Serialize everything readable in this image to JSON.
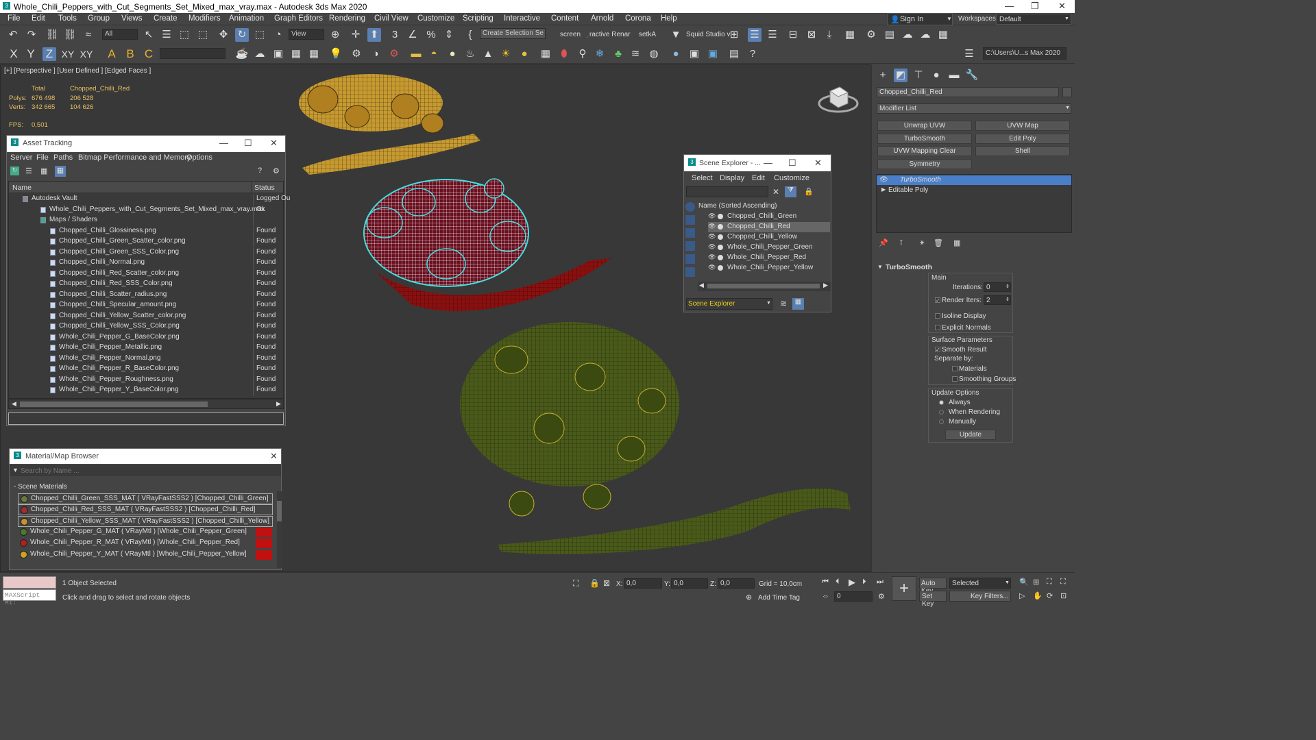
{
  "window": {
    "title": "Whole_Chili_Peppers_with_Cut_Segments_Set_Mixed_max_vray.max - Autodesk 3ds Max 2020"
  },
  "menu": [
    "File",
    "Edit",
    "Tools",
    "Group",
    "Views",
    "Create",
    "Modifiers",
    "Animation",
    "Graph Editors",
    "Rendering",
    "Civil View",
    "Customize",
    "Scripting",
    "Interactive",
    "Content",
    "Arnold",
    "Corona",
    "Help"
  ],
  "account": {
    "sign_in": "Sign In",
    "workspaces_label": "Workspaces:",
    "workspace": "Default"
  },
  "toolbar": {
    "filter": "All",
    "ref_coord": "View",
    "selection_set": "Create Selection Se",
    "screen": "screen",
    "interactive_render": "̣ractive Renar",
    "setka": "setkA",
    "squid": "Squid Studio v",
    "path": "C:\\Users\\U...s Max 2020"
  },
  "axis": {
    "x": "X",
    "y": "Y",
    "z": "Z",
    "xy": "XY",
    "xyz": "XY"
  },
  "brush": {
    "b1": "A",
    "b2": "B",
    "b3": "C"
  },
  "viewport": {
    "label": "[+] [Perspective ] [User Defined ] [Edged Faces ]",
    "stats": {
      "total_header": "Total",
      "object_header": "Chopped_Chilli_Red",
      "polys_label": "Polys:",
      "polys_total": "676 498",
      "polys_obj": "206 528",
      "verts_label": "Verts:",
      "verts_total": "342 665",
      "verts_obj": "104 626",
      "fps_label": "FPS:",
      "fps": "0,501"
    }
  },
  "asset_tracking": {
    "title": "Asset Tracking",
    "menu": [
      "Server",
      "File",
      "Paths",
      "Bitmap Performance and Memory",
      "Options"
    ],
    "col_name": "Name",
    "col_status": "Status",
    "rows": [
      {
        "name": "Autodesk Vault",
        "status": "Logged Ou",
        "indent": 1
      },
      {
        "name": "Whole_Chili_Peppers_with_Cut_Segments_Set_Mixed_max_vray.max",
        "status": "Ok",
        "indent": 2
      },
      {
        "name": "Maps / Shaders",
        "status": "",
        "indent": 3
      },
      {
        "name": "Chopped_Chilli_Glossiness.png",
        "status": "Found",
        "indent": 4
      },
      {
        "name": "Chopped_Chilli_Green_Scatter_color.png",
        "status": "Found",
        "indent": 4
      },
      {
        "name": "Chopped_Chilli_Green_SSS_Color.png",
        "status": "Found",
        "indent": 4
      },
      {
        "name": "Chopped_Chilli_Normal.png",
        "status": "Found",
        "indent": 4
      },
      {
        "name": "Chopped_Chilli_Red_Scatter_color.png",
        "status": "Found",
        "indent": 4
      },
      {
        "name": "Chopped_Chilli_Red_SSS_Color.png",
        "status": "Found",
        "indent": 4
      },
      {
        "name": "Chopped_Chilli_Scatter_radius.png",
        "status": "Found",
        "indent": 4
      },
      {
        "name": "Chopped_Chilli_Specular_amount.png",
        "status": "Found",
        "indent": 4
      },
      {
        "name": "Chopped_Chilli_Yellow_Scatter_color.png",
        "status": "Found",
        "indent": 4
      },
      {
        "name": "Chopped_Chilli_Yellow_SSS_Color.png",
        "status": "Found",
        "indent": 4
      },
      {
        "name": "Whole_Chili_Pepper_G_BaseColor.png",
        "status": "Found",
        "indent": 4
      },
      {
        "name": "Whole_Chili_Pepper_Metallic.png",
        "status": "Found",
        "indent": 4
      },
      {
        "name": "Whole_Chili_Pepper_Normal.png",
        "status": "Found",
        "indent": 4
      },
      {
        "name": "Whole_Chili_Pepper_R_BaseColor.png",
        "status": "Found",
        "indent": 4
      },
      {
        "name": "Whole_Chili_Pepper_Roughness.png",
        "status": "Found",
        "indent": 4
      },
      {
        "name": "Whole_Chili_Pepper_Y_BaseColor.png",
        "status": "Found",
        "indent": 4
      }
    ]
  },
  "material_browser": {
    "title": "Material/Map Browser",
    "search_placeholder": "Search by Name ...",
    "group": "- Scene Materials",
    "items": [
      {
        "label": "Chopped_Chilli_Green_SSS_MAT ( VRayFastSSS2 ) [Chopped_Chilli_Green]",
        "color": "#6a7a3a"
      },
      {
        "label": "Chopped_Chilli_Red_SSS_MAT ( VRayFastSSS2 ) [Chopped_Chilli_Red]",
        "color": "#a03030"
      },
      {
        "label": "Chopped_Chilli_Yellow_SSS_MAT ( VRayFastSSS2 ) [Chopped_Chilli_Yellow]",
        "color": "#c89030"
      },
      {
        "label": "Whole_Chili_Pepper_G_MAT ( VRayMtl ) [Whole_Chili_Pepper_Green]",
        "color": "#4a7a2a"
      },
      {
        "label": "Whole_Chili_Pepper_R_MAT ( VRayMtl ) [Whole_Chili_Pepper_Red]",
        "color": "#b02020"
      },
      {
        "label": "Whole_Chili_Pepper_Y_MAT ( VRayMtl ) [Whole_Chili_Pepper_Yellow]",
        "color": "#d0a020"
      }
    ]
  },
  "scene_explorer": {
    "title": "Scene Explorer - ...",
    "menu": [
      "Select",
      "Display",
      "Edit",
      "Customize"
    ],
    "header": "Name (Sorted Ascending)",
    "items": [
      "Chopped_Chilli_Green",
      "Chopped_Chilli_Red",
      "Chopped_Chilli_Yellow",
      "Whole_Chili_Pepper_Green",
      "Whole_Chili_Pepper_Red",
      "Whole_Chili_Pepper_Yellow"
    ],
    "selected_index": 1,
    "footer": "Scene Explorer"
  },
  "command_panel": {
    "object_name": "Chopped_Chilli_Red",
    "modifier_list": "Modifier List",
    "buttons": [
      "Unwrap UVW",
      "UVW Map",
      "TurboSmooth",
      "Edit Poly",
      "UVW Mapping Clear",
      "Shell",
      "Symmetry"
    ],
    "stack": [
      "TurboSmooth",
      "Editable Poly"
    ],
    "rollout_title": "TurboSmooth",
    "main_label": "Main",
    "iterations_label": "Iterations:",
    "iterations": "0",
    "render_iters_label": "Render Iters:",
    "render_iters": "2",
    "isoline": "Isoline Display",
    "explicit_normals": "Explicit Normals",
    "surface_params": "Surface Parameters",
    "smooth_result": "Smooth Result",
    "separate_by": "Separate by:",
    "materials": "Materials",
    "smoothing_groups": "Smoothing Groups",
    "update_options": "Update Options",
    "always": "Always",
    "when_rendering": "When Rendering",
    "manually": "Manually",
    "update": "Update"
  },
  "status": {
    "maxscript": "MAXScript Mi:",
    "selected": "1 Object Selected",
    "prompt": "Click and drag to select and rotate objects",
    "x_label": "X:",
    "x": "0,0",
    "y_label": "Y:",
    "y": "0,0",
    "z_label": "Z:",
    "z": "0,0",
    "grid": "Grid = 10,0cm",
    "add_time_tag": "Add Time Tag",
    "auto_key": "Auto Key",
    "set_key": "Set Key",
    "key_mode": "Selected",
    "key_filters": "Key Filters...",
    "frame": "0"
  },
  "colors": {
    "accent": "#4a7ec8",
    "found": "#dddddd",
    "selection": "#3a6ea5"
  }
}
